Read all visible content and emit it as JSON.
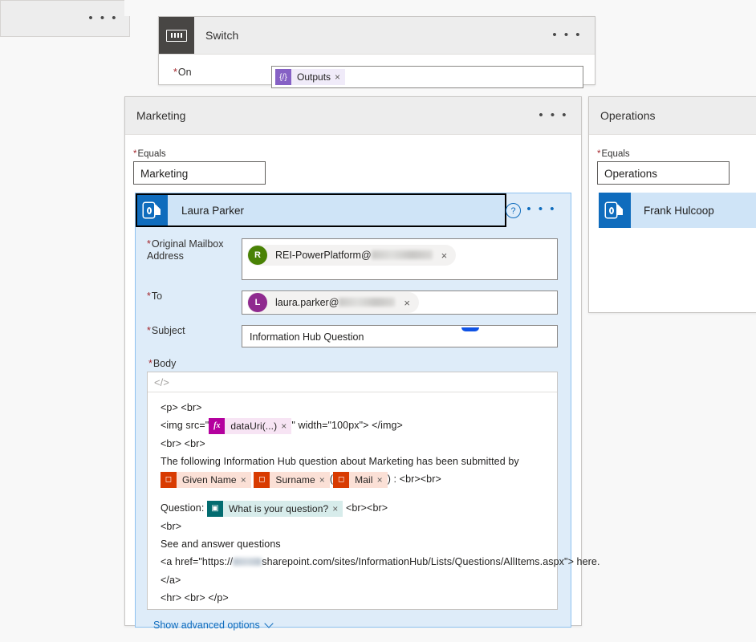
{
  "flow": {
    "switch_card": {
      "title": "Switch",
      "icon": "switch-icon",
      "on_label": "On",
      "on_required": "*",
      "token": {
        "text": "Outputs",
        "icon": "expression-braces-icon",
        "remove": "×"
      },
      "menu": "• • •"
    },
    "cases": [
      {
        "name": "case-left-partial",
        "title": "",
        "menu": "• • •"
      },
      {
        "name": "case-marketing",
        "title": "Marketing",
        "menu": "• • •",
        "equals_label": "Equals",
        "equals_required": "*",
        "equals_value": "Marketing",
        "action": {
          "name": "Laura Parker",
          "icon": "outlook-icon",
          "help": "?",
          "menu": "• • •",
          "fields": {
            "mailbox_label": "Original Mailbox Address",
            "mailbox_required": "*",
            "mailbox_value": "REI-PowerPlatform@",
            "mailbox_initial": "R",
            "to_label": "To",
            "to_required": "*",
            "to_value": "laura.parker@",
            "to_initial": "L",
            "subject_label": "Subject",
            "subject_required": "*",
            "subject_value": "Information Hub Question",
            "body_label": "Body",
            "body_required": "*",
            "remove": "×"
          },
          "advanced_label": "Show advanced options"
        }
      },
      {
        "name": "case-operations",
        "title": "Operations",
        "menu": "• • •",
        "equals_label": "Equals",
        "equals_required": "*",
        "equals_value": "Operations",
        "action": {
          "name": "Frank Hulcoop",
          "icon": "outlook-icon"
        }
      }
    ]
  },
  "body_editor": {
    "toolbar_icon": "code-view-icon",
    "lines": {
      "l1": "<p> <br>",
      "l2_pre": "<img src=\"",
      "l2_post": "\" width=\"100px\"> </img>",
      "l3": "<br> <br>",
      "l4": "The following Information Hub question about Marketing has been submitted by",
      "l5_open": "(",
      "l5_close": ") : <br><br>",
      "l6_pre": "Question:",
      "l6_post": "<br><br>",
      "l7": "<br>",
      "l8": "See and answer questions",
      "l9_pre": "<a href=\"https://",
      "l9_post": "sharepoint.com/sites/InformationHub/Lists/Questions/AllItems.aspx\"> here.",
      "l10": "</a>",
      "l11": "<hr> <br> </p>"
    },
    "tokens": {
      "datauri": {
        "text": "dataUri(...)",
        "icon": "fx-expression-icon",
        "remove": "×"
      },
      "given_name": {
        "text": "Given Name",
        "icon": "office365-users-icon",
        "remove": "×"
      },
      "surname": {
        "text": "Surname",
        "icon": "office365-users-icon",
        "remove": "×"
      },
      "mail": {
        "text": "Mail",
        "icon": "office365-users-icon",
        "remove": "×"
      },
      "question": {
        "text": "What is your question?",
        "icon": "sharepoint-icon",
        "remove": "×"
      }
    }
  },
  "colors": {
    "accent_blue": "#0f6cbd",
    "node_dot_blue": "#0f53e5",
    "selected_bg": "#deecf9",
    "selected_head": "#cfe4f7",
    "operation_tile": "#484644",
    "required_red": "#a4262c",
    "token_purple": "#8661c5",
    "token_magenta": "#b4009e",
    "token_orange": "#d83b01",
    "token_teal": "#036c70"
  }
}
